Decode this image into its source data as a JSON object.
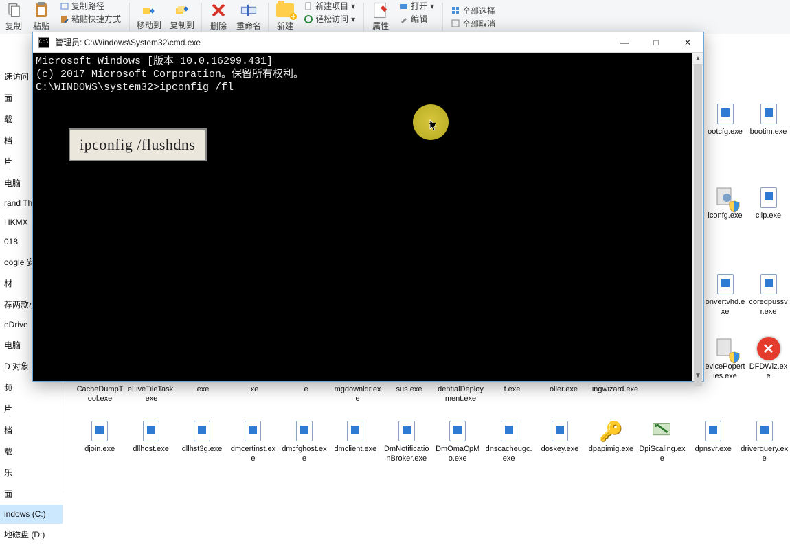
{
  "ribbon": {
    "copy_label": "复制",
    "paste_label": "粘贴",
    "copy_path": "复制路径",
    "paste_shortcut": "粘贴快捷方式",
    "move_to": "移动到",
    "copy_to": "复制到",
    "delete": "删除",
    "rename": "重命名",
    "new": "新建",
    "new_item": "新建项目",
    "easy_access": "轻松访问",
    "properties": "属性",
    "open": "打开",
    "edit": "编辑",
    "select_all": "全部选择",
    "select_none": "全部取消"
  },
  "sidebar": {
    "items": [
      "速访问",
      "面",
      "载",
      "档",
      "片",
      "电脑",
      "rand The",
      "HKMX",
      "018",
      "oogle 安",
      "材",
      "荐两款小",
      "eDrive",
      "电脑",
      "D 对象",
      "频",
      "片",
      "档",
      "载",
      "乐",
      "面",
      "indows (C:)",
      "地磁盘 (D:)"
    ],
    "selected_index": 21
  },
  "cmd": {
    "title": "管理员: C:\\Windows\\System32\\cmd.exe",
    "lines": [
      "Microsoft Windows [版本 10.0.16299.431]",
      "(c) 2017 Microsoft Corporation。保留所有权利。",
      "",
      "C:\\WINDOWS\\system32>ipconfig /fl"
    ],
    "min_tip": "—",
    "max_tip": "□",
    "close_tip": "✕"
  },
  "overlay_hint": "ipconfig /flushdns",
  "files_right_top": [
    {
      "name": "ootcfg.exe"
    },
    {
      "name": "bootim.exe"
    },
    {
      "name": "iconfg.exe"
    },
    {
      "name": "clip.exe"
    },
    {
      "name": "onvertvhd.exe"
    },
    {
      "name": "coredpussvr.exe"
    },
    {
      "name": "evicePoperties.exe"
    },
    {
      "name": "DFDWiz.exe"
    }
  ],
  "files_row_bottom1": [
    {
      "name": "CacheDumpTool.exe"
    },
    {
      "name": "eLiveTileTask.exe"
    },
    {
      "name": "exe"
    },
    {
      "name": "xe"
    },
    {
      "name": "e"
    },
    {
      "name": "mgdownldr.exe"
    },
    {
      "name": "sus.exe"
    },
    {
      "name": "dentialDeployment.exe"
    },
    {
      "name": "t.exe"
    },
    {
      "name": "oller.exe"
    },
    {
      "name": "ingwizard.exe"
    }
  ],
  "files_row_bottom2": [
    {
      "name": "djoin.exe"
    },
    {
      "name": "dllhost.exe"
    },
    {
      "name": "dllhst3g.exe"
    },
    {
      "name": "dmcertinst.exe"
    },
    {
      "name": "dmcfghost.exe"
    },
    {
      "name": "dmclient.exe"
    },
    {
      "name": "DmNotificationBroker.exe"
    },
    {
      "name": "DmOmaCpMo.exe"
    },
    {
      "name": "dnscacheugc.exe"
    },
    {
      "name": "doskey.exe"
    },
    {
      "name": "dpapimig.exe"
    },
    {
      "name": "DpiScaling.exe"
    },
    {
      "name": "dpnsvr.exe"
    },
    {
      "name": "driverquery.exe"
    }
  ],
  "icons": {
    "key": "🔑"
  }
}
